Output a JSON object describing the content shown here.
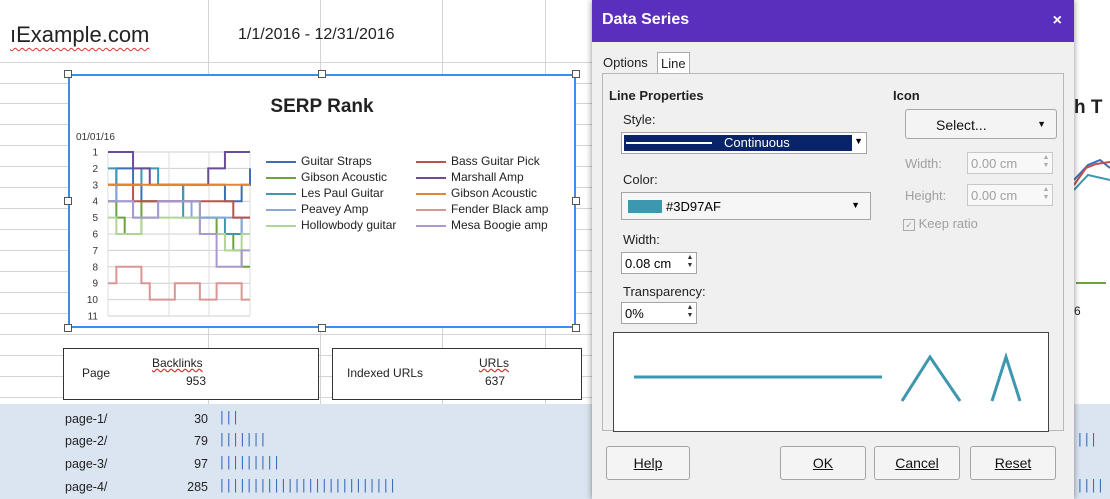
{
  "sheet": {
    "site_name": "ıExample.com",
    "date_range": "1/1/2016 - 12/31/2016",
    "partial_right_text": "h T",
    "partial_right_num": "6",
    "summary": {
      "page_label": "Page",
      "backlinks_label": "Backlinks",
      "backlinks_value": "953",
      "indexed_label": "Indexed URLs",
      "urls_label": "URLs",
      "urls_value": "637"
    },
    "rows": [
      {
        "page": "page-1/",
        "count": "30",
        "bars": "|||"
      },
      {
        "page": "page-2/",
        "count": "79",
        "bars": "|||||||"
      },
      {
        "page": "page-3/",
        "count": "97",
        "bars": "|||||||||"
      },
      {
        "page": "page-4/",
        "count": "285",
        "bars": "||||||||||||||||||||||||||"
      }
    ]
  },
  "chart_data": {
    "type": "line",
    "title": "SERP Rank",
    "xlabel": "01/01/16",
    "ylabel": "",
    "ylim": [
      1,
      11
    ],
    "y_inverted": true,
    "y_ticks": [
      "1",
      "2",
      "3",
      "4",
      "5",
      "6",
      "7",
      "8",
      "9",
      "10",
      "11"
    ],
    "x": [
      1,
      2,
      3,
      4,
      5,
      6,
      7,
      8,
      9,
      10,
      11,
      12,
      13,
      14,
      15,
      16,
      17,
      18
    ],
    "series": [
      {
        "name": "Guitar Straps",
        "color": "#3b6fb8",
        "values": [
          4,
          2,
          2,
          3,
          4,
          4,
          4,
          4,
          4,
          3,
          3,
          3,
          3,
          3,
          4,
          4,
          3,
          2
        ]
      },
      {
        "name": "Gibson Acoustic",
        "color": "#6da33c",
        "values": [
          4,
          5,
          6,
          6,
          4,
          4,
          4,
          4,
          4,
          4,
          4,
          5,
          5,
          6,
          6,
          7,
          8,
          8
        ]
      },
      {
        "name": "Les Paul Guitar",
        "color": "#3d97af",
        "values": [
          2,
          3,
          3,
          3,
          2,
          2,
          3,
          3,
          3,
          5,
          5,
          5,
          5,
          5,
          6,
          6,
          5,
          5
        ]
      },
      {
        "name": "Peavey Amp",
        "color": "#8aa7dc",
        "values": [
          3,
          4,
          4,
          5,
          5,
          5,
          4,
          4,
          4,
          4,
          5,
          5,
          5,
          5,
          5,
          5,
          6,
          6
        ]
      },
      {
        "name": "Hollowbody guitar",
        "color": "#b2d597",
        "values": [
          5,
          6,
          6,
          6,
          5,
          5,
          5,
          5,
          5,
          5,
          5,
          6,
          6,
          6,
          7,
          7,
          6,
          6
        ]
      },
      {
        "name": "Bass Guitar Pick",
        "color": "#c0504d",
        "values": [
          3,
          3,
          3,
          4,
          4,
          4,
          4,
          4,
          4,
          4,
          4,
          4,
          4,
          4,
          4,
          5,
          5,
          5
        ]
      },
      {
        "name": "Marshall Amp",
        "color": "#6b4c9a",
        "values": [
          1,
          1,
          1,
          2,
          2,
          3,
          3,
          3,
          3,
          3,
          3,
          3,
          2,
          2,
          1,
          1,
          1,
          1
        ]
      },
      {
        "name": "Gibson Acoustic",
        "color": "#e5862e",
        "values": [
          3,
          3,
          3,
          3,
          3,
          3,
          3,
          3,
          3,
          3,
          3,
          3,
          3,
          3,
          3,
          3,
          3,
          3
        ]
      },
      {
        "name": "Fender Black amp",
        "color": "#d99694",
        "values": [
          9,
          8,
          8,
          8,
          9,
          10,
          10,
          10,
          9,
          9,
          9,
          10,
          10,
          9,
          9,
          9,
          10,
          10
        ]
      },
      {
        "name": "Mesa Boogie amp",
        "color": "#a89ad0",
        "values": [
          4,
          4,
          4,
          5,
          5,
          5,
          4,
          4,
          4,
          4,
          4,
          6,
          6,
          8,
          8,
          8,
          7,
          7
        ]
      }
    ]
  },
  "dialog": {
    "title": "Data Series",
    "close_glyph": "×",
    "tabs": [
      {
        "label": "Options"
      },
      {
        "label": "Line"
      }
    ],
    "line_properties": {
      "heading": "Line Properties",
      "style_label": "Style:",
      "style_value": "Continuous",
      "color_label": "Color:",
      "color_value": "#3D97AF",
      "color_hex": "#3D97AF",
      "width_label": "Width:",
      "width_value": "0.08 cm",
      "transparency_label": "Transparency:",
      "transparency_value": "0%"
    },
    "icon": {
      "heading": "Icon",
      "select_label": "Select...",
      "width_label": "Width:",
      "width_value": "0.00 cm",
      "height_label": "Height:",
      "height_value": "0.00 cm",
      "keep_ratio_label": "Keep ratio",
      "keep_ratio_checked": true
    },
    "buttons": {
      "help": "Help",
      "ok": "OK",
      "cancel": "Cancel",
      "reset": "Reset"
    }
  }
}
